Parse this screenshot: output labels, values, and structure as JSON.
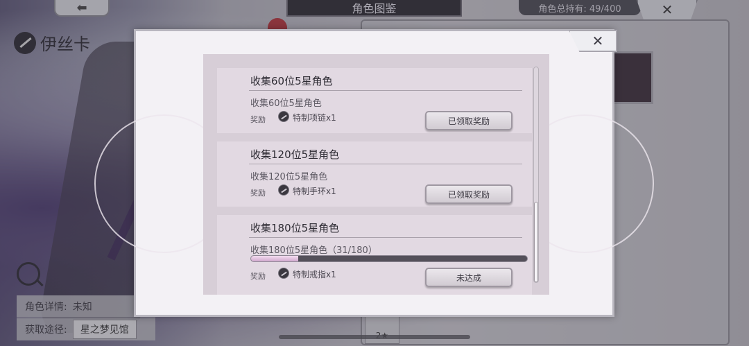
{
  "background": {
    "back_icon": "arrow-left-icon",
    "back_glyph": "⬅",
    "screen_title": "角色图鉴",
    "owned_count": "角色总持有: 49/400",
    "close_glyph": "✕",
    "character_name": "伊丝卡",
    "details_label": "角色详情:",
    "details_value": "未知",
    "obtain_label": "获取途径:",
    "obtain_value": "星之梦见馆",
    "star_tag": "2★"
  },
  "modal": {
    "close_glyph": "✕",
    "items": [
      {
        "title": "收集60位5星角色",
        "description": "收集60位5星角色",
        "reward_label": "奖励",
        "reward_icon": "necklace-icon",
        "reward_name": "特制项链x1",
        "button_label": "已领取奖励"
      },
      {
        "title": "收集120位5星角色",
        "description": "收集120位5星角色",
        "reward_label": "奖励",
        "reward_icon": "bracelet-icon",
        "reward_name": "特制手环x1",
        "button_label": "已领取奖励"
      },
      {
        "title": "收集180位5星角色",
        "description": "收集180位5星角色（31/180）",
        "reward_label": "奖励",
        "reward_icon": "ring-icon",
        "reward_name": "特制戒指x1",
        "button_label": "未达成",
        "progress": 0.172
      }
    ]
  },
  "colors": {
    "progress_fill": "#d2a9cf",
    "card_bg": "#e2d9e2",
    "panel_bg": "#d7ced7"
  }
}
